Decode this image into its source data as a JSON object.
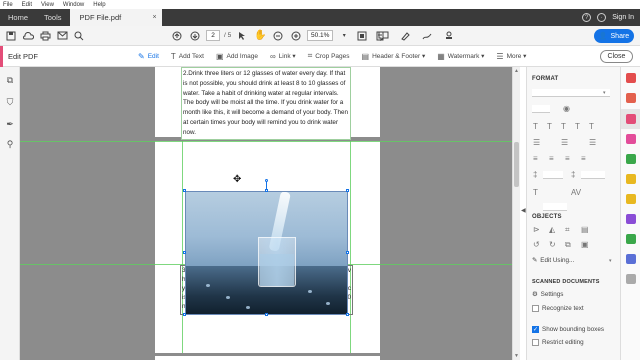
{
  "menu": [
    "File",
    "Edit",
    "View",
    "Window",
    "Help"
  ],
  "tabs": {
    "home": "Home",
    "tools": "Tools",
    "file": "PDF File.pdf",
    "close": "×"
  },
  "account": {
    "signin": "Sign In"
  },
  "toolbar": {
    "page_current": "2",
    "page_total": "/ 5",
    "zoom": "50.1%",
    "share_label": "Share"
  },
  "editbar": {
    "title": "Edit PDF",
    "items": [
      "Edit",
      "Add Text",
      "Add Image",
      "Link ▾",
      "Crop Pages",
      "Header & Footer ▾",
      "Watermark ▾",
      "More ▾"
    ],
    "close_label": "Close"
  },
  "document": {
    "paragraph": "2.Drink three liters or 12 glasses of water every day. If that is not possible, you should drink at least 8 to 10 glasses of water. Take a habit of drinking water at regular intervals. The body will be moist all the time. If you drink water for a month like this, it will become a demand of your body. Then at certain times your body will remind you to drink water now.",
    "peek_left": [
      "3.",
      "h",
      "y",
      "is",
      "t",
      "n"
    ],
    "peek_right": [
      "v",
      "",
      "c",
      "0",
      ""
    ]
  },
  "panel": {
    "format_header": "FORMAT",
    "objects_header": "OBJECTS",
    "edit_using": "Edit Using...",
    "scanned_header": "SCANNED DOCUMENTS",
    "settings": "Settings",
    "recognize": "Recognize text",
    "show_bbox": "Show bounding boxes",
    "restrict": "Restrict editing"
  },
  "colors": {
    "accent": "#1473e6",
    "editbar_accent": "#e34d78",
    "guide": "#5fce5f",
    "tabbar": "#3a3a3a"
  }
}
